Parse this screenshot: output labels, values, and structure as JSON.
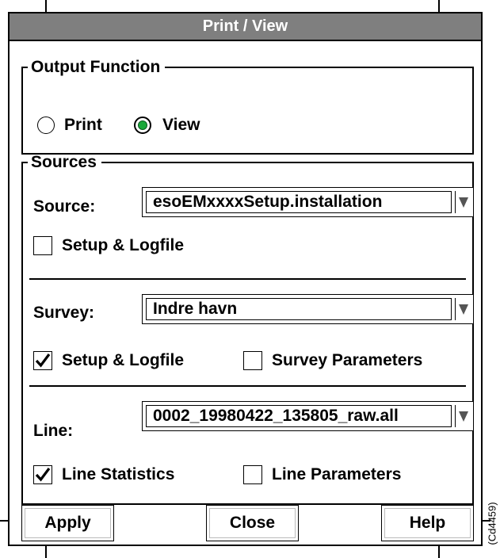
{
  "window": {
    "title": "Print / View"
  },
  "output_function": {
    "legend": "Output Function",
    "options": [
      {
        "label": "Print",
        "selected": false
      },
      {
        "label": "View",
        "selected": true
      }
    ]
  },
  "sources": {
    "legend": "Sources",
    "source": {
      "label": "Source:",
      "value": "esoEMxxxxSetup.installation",
      "checkbox": {
        "label": "Setup & Logfile",
        "checked": false
      }
    },
    "survey": {
      "label": "Survey:",
      "value": "Indre havn",
      "checkboxes": [
        {
          "label": "Setup & Logfile",
          "checked": true
        },
        {
          "label": "Survey Parameters",
          "checked": false
        }
      ]
    },
    "line": {
      "label": "Line:",
      "value": "0002_19980422_135805_raw.all",
      "checkboxes": [
        {
          "label": "Line Statistics",
          "checked": true
        },
        {
          "label": "Line Parameters",
          "checked": false
        }
      ]
    }
  },
  "buttons": {
    "apply": "Apply",
    "close": "Close",
    "help": "Help"
  },
  "figure_id": "(Cd4459)",
  "icons": {
    "checkmark": "checkmark-icon",
    "dropdown": "dropdown-arrow-icon"
  },
  "colors": {
    "titlebar": "#7f7f7f",
    "radio_selected": "#1aa83a"
  }
}
